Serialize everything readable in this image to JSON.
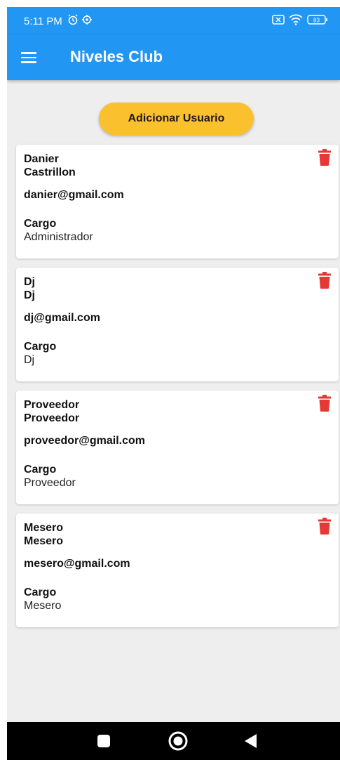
{
  "status_bar": {
    "time": "5:11 PM",
    "battery": "83",
    "icons": [
      "alarm-icon",
      "settings-icon",
      "sim-icon",
      "wifi-icon",
      "battery-icon"
    ]
  },
  "app_bar": {
    "title": "Niveles Club",
    "menu_icon": "menu-icon",
    "color": "#2196f3"
  },
  "add_button": {
    "label": "Adicionar Usuario",
    "color": "#fbc02d"
  },
  "users": [
    {
      "first_name": "Danier",
      "last_name": "Castrillon",
      "email": "danier@gmail.com",
      "cargo_label": "Cargo",
      "cargo": "Administrador"
    },
    {
      "first_name": "Dj",
      "last_name": "Dj",
      "email": "dj@gmail.com",
      "cargo_label": "Cargo",
      "cargo": "Dj"
    },
    {
      "first_name": "Proveedor",
      "last_name": "Proveedor",
      "email": "proveedor@gmail.com",
      "cargo_label": "Cargo",
      "cargo": "Proveedor"
    },
    {
      "first_name": "Mesero",
      "last_name": "Mesero",
      "email": "mesero@gmail.com",
      "cargo_label": "Cargo",
      "cargo": "Mesero"
    }
  ],
  "delete_icon_color": "#e53935",
  "nav_bar": {
    "buttons": [
      "recent-apps-icon",
      "home-icon",
      "back-icon"
    ]
  }
}
